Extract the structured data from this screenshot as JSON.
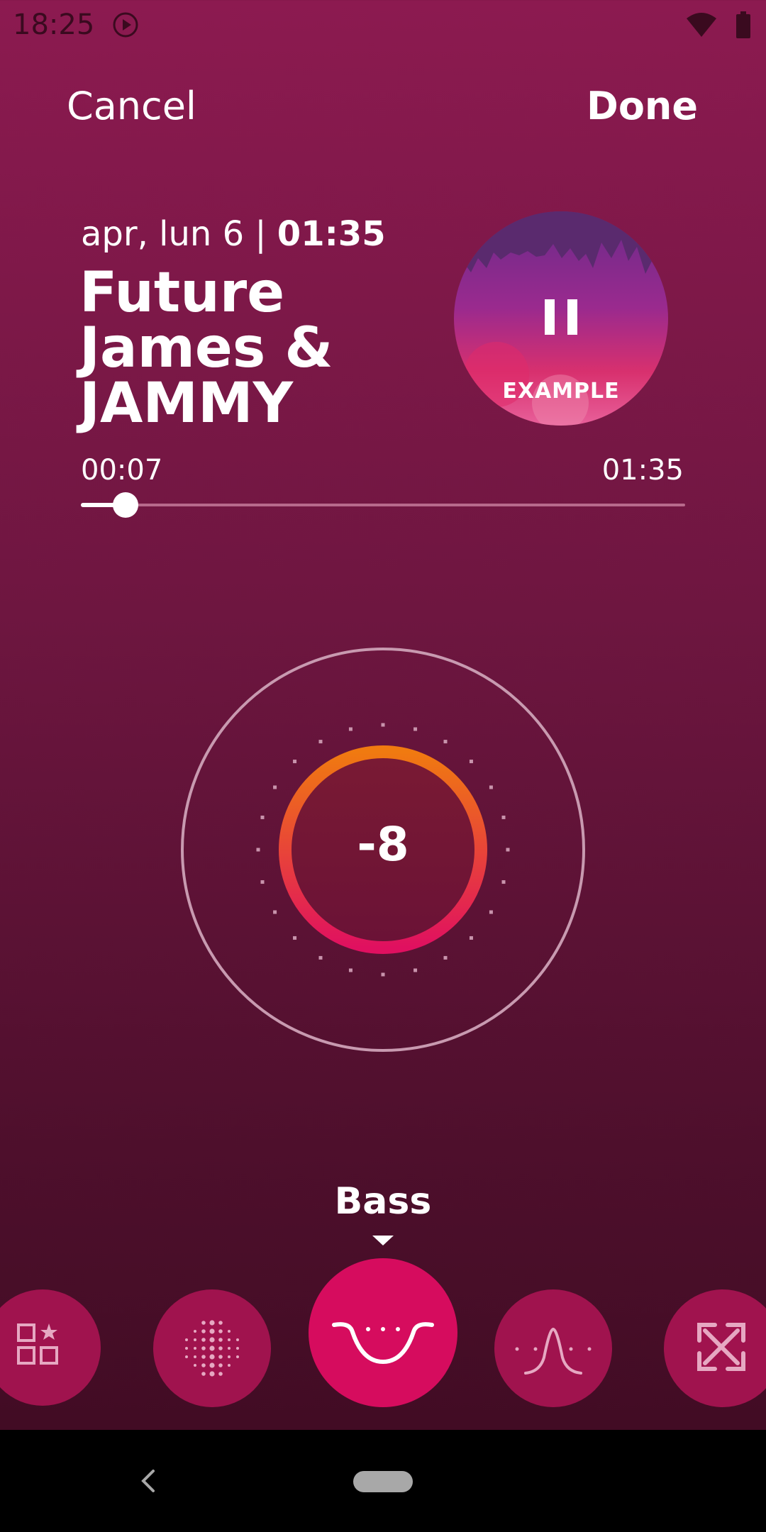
{
  "status_bar": {
    "time": "18:25",
    "icons": [
      "play-circle-icon",
      "wifi-icon",
      "battery-icon"
    ]
  },
  "header": {
    "cancel_label": "Cancel",
    "done_label": "Done"
  },
  "track": {
    "date_prefix": "apr, lun 6 | ",
    "duration_bold": "01:35",
    "title": "Future James & JAMMY",
    "album_label": "EXAMPLE",
    "album_icon": "pause-icon"
  },
  "progress": {
    "elapsed": "00:07",
    "total": "01:35",
    "fraction": 0.0737
  },
  "equalizer": {
    "value": "-8",
    "mode_label": "Bass",
    "modes": [
      {
        "icon": "presets-grid-star-icon",
        "active": false
      },
      {
        "icon": "dot-sphere-icon",
        "active": false
      },
      {
        "icon": "bass-curve-icon",
        "active": true
      },
      {
        "icon": "mid-peak-curve-icon",
        "active": false
      },
      {
        "icon": "expand-arrows-icon",
        "active": false
      }
    ]
  },
  "colors": {
    "background_top": "#8c1a50",
    "background_bottom": "#3d0b21",
    "accent": "#d60c5e",
    "button": "#a0134e",
    "ring_gradient_start": "#f07a10",
    "ring_gradient_end": "#e01060"
  },
  "nav_bar": {
    "icons": [
      "back-icon",
      "home-pill-icon"
    ]
  }
}
